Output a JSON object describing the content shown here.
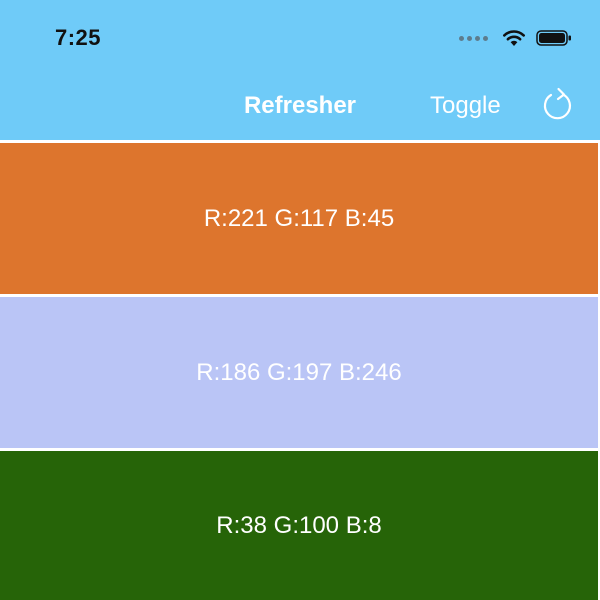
{
  "status_bar": {
    "time": "7:25",
    "icons": [
      "cellular-dots-icon",
      "wifi-icon",
      "battery-icon"
    ]
  },
  "nav_bar": {
    "title": "Refresher",
    "toggle_label": "Toggle",
    "refresh_icon": "refresh-icon",
    "background": "#6FCBF8"
  },
  "rows": [
    {
      "label": "R:221 G:117 B:45",
      "color": "#DD752D"
    },
    {
      "label": "R:186 G:197 B:246",
      "color": "#BAC5F6"
    },
    {
      "label": "R:38 G:100 B:8",
      "color": "#266408"
    }
  ]
}
